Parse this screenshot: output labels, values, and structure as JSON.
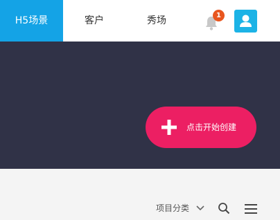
{
  "header": {
    "tabs": [
      {
        "label": "H5场景"
      },
      {
        "label": "客户"
      },
      {
        "label": "秀场"
      }
    ],
    "notification_count": "1"
  },
  "hero": {
    "create_label": "点击开始创建"
  },
  "toolbar": {
    "category_label": "项目分类"
  },
  "colors": {
    "accent_blue": "#14a3e6",
    "hero_bg": "#303247",
    "create_pink": "#ec1f63",
    "badge_orange": "#e8561f"
  },
  "icons": [
    "bell-icon",
    "user-icon",
    "plus-icon",
    "chevron-down-icon",
    "search-icon",
    "menu-icon"
  ]
}
